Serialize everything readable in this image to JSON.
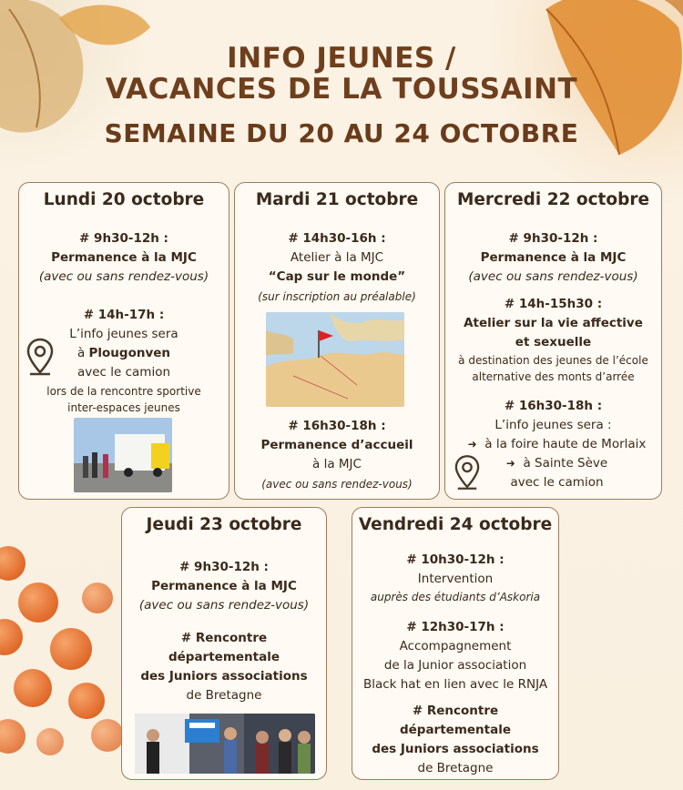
{
  "header": {
    "line1": "INFO JEUNES /",
    "line2": "VACANCES DE LA TOUSSAINT",
    "line3": "SEMAINE DU 20 AU 24 OCTOBRE"
  },
  "colors": {
    "title": "#6f3f1d",
    "border": "#9b7d5c",
    "card_bg": "#fffaf3",
    "accent_orange": "#e06a2a"
  },
  "monday": {
    "day": "Lundi 20 octobre",
    "time1": "# 9h30-12h :",
    "act1": "Permanence à la MJC",
    "note1": "(avec ou sans rendez-vous)",
    "time2": "#  14h-17h :",
    "l1": "L’info  jeunes sera",
    "l2_pre": "à ",
    "l2_bold": "Plougonven",
    "l3": "avec le camion",
    "l4": "lors de la rencontre sportive",
    "l5": "inter-espaces jeunes",
    "icon": "map-pin-icon"
  },
  "tuesday": {
    "day": "Mardi 21 octobre",
    "time1": "# 14h30-16h :",
    "act1": "Atelier à la MJC",
    "act1b": "“Cap sur le monde”",
    "note1": "(sur inscription au préalable)",
    "time2": "# 16h30-18h :",
    "act2": "Permanence d’accueil",
    "act2b": "à la MJC",
    "note2": "(avec ou sans rendez-vous)"
  },
  "wednesday": {
    "day": "Mercredi 22 octobre",
    "time1": "# 9h30-12h :",
    "act1": "Permanence à la MJC",
    "note1": "(avec ou sans rendez-vous)",
    "time2": "# 14h-15h30 :",
    "act2a": "Atelier sur la vie affective",
    "act2b": "et sexuelle",
    "desc1": "à destination des jeunes de l’école",
    "desc2": "alternative des monts d’arrée",
    "time3": "# 16h30-18h :",
    "l1": "L’info jeunes sera  :",
    "l2": "à la foire haute de Morlaix",
    "l3": "à Sainte Sève",
    "l4": "avec le camion",
    "arrow": "➜"
  },
  "thursday": {
    "day": "Jeudi 23 octobre",
    "time1": "# 9h30-12h :",
    "act1": "Permanence à la MJC",
    "note1": "(avec ou sans rendez-vous)",
    "act2a": "# Rencontre",
    "act2b": "départementale",
    "act2c": "des Juniors associations",
    "act2d": "de Bretagne"
  },
  "friday": {
    "day": "Vendredi 24 octobre",
    "time1": "# 10h30-12h :",
    "act1": "Intervention",
    "act1b": "auprès des étudiants d’Askoria",
    "time2": "# 12h30-17h :",
    "act2a": "Accompagnement",
    "act2b": "de la Junior association",
    "act2c": "Black hat  en lien avec le RNJA",
    "act3a": "# Rencontre",
    "act3b": "départementale",
    "act3c": "des Juniors associations",
    "act3d": "de Bretagne"
  }
}
